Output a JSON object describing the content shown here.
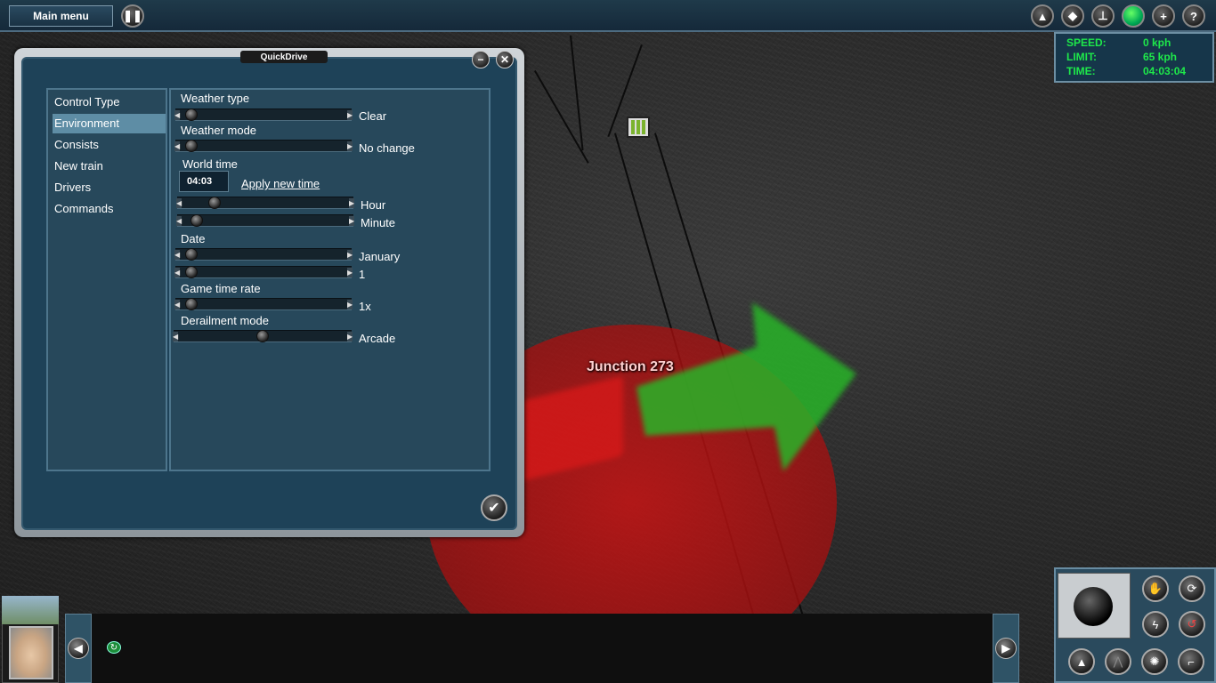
{
  "topbar": {
    "main_menu_label": "Main menu",
    "pause_icon": "pause-icon",
    "right_icons": [
      "camera-icon",
      "layers-icon",
      "switch-icon",
      "green-signal-icon",
      "add-icon",
      "help-icon"
    ]
  },
  "hud": {
    "speed_label": "SPEED:",
    "speed_value": "0 kph",
    "limit_label": "LIMIT:",
    "limit_value": "65 kph",
    "time_label": "TIME:",
    "time_value": "04:03:04",
    "text_color": "#1ee84a"
  },
  "dialog": {
    "title": "QuickDrive",
    "nav": [
      "Control Type",
      "Environment",
      "Consists",
      "New train",
      "Drivers",
      "Commands"
    ],
    "active_nav": "Environment",
    "weather_type_label": "Weather type",
    "weather_type_value": "Clear",
    "weather_type_level": 0.03,
    "weather_mode_label": "Weather mode",
    "weather_mode_value": "No change",
    "weather_mode_level": 0.03,
    "world_time_label": "World time",
    "world_time_value": "04:03",
    "apply_label": "Apply new time",
    "hour_label": "Hour",
    "hour_level": 0.17,
    "minute_label": "Minute",
    "minute_level": 0.05,
    "date_label": "Date",
    "month_value": "January",
    "month_level": 0.03,
    "day_value": "1",
    "day_level": 0.03,
    "game_time_rate_label": "Game time rate",
    "game_time_rate_value": "1x",
    "game_time_rate_level": 0.03,
    "derailment_label": "Derailment mode",
    "derailment_value": "Arcade",
    "derailment_level": 0.5
  },
  "scene": {
    "junction_label": "Junction 273"
  },
  "bottom": {
    "prev_icon": "arrow-left-icon",
    "next_icon": "arrow-right-icon"
  }
}
